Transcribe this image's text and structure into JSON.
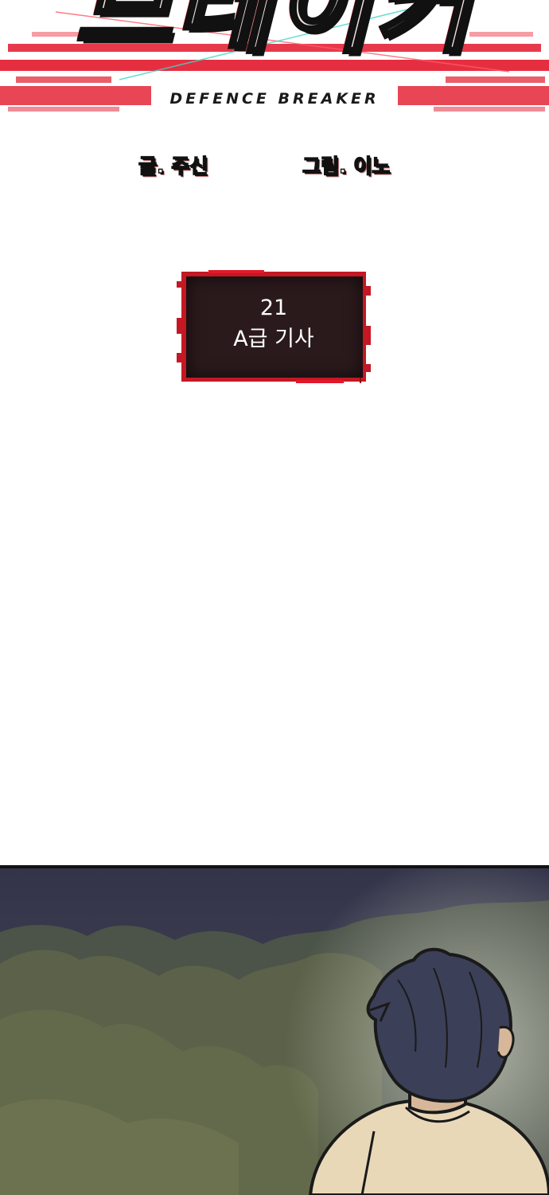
{
  "series": {
    "title_korean": "브레이커",
    "title_english": "DEFENCE BREAKER"
  },
  "credits": {
    "writer": "글. 주신",
    "artist": "그림. 이노"
  },
  "chapter": {
    "number": "21",
    "title": "A급 기사"
  },
  "colors": {
    "accent_red": "#e2182b",
    "chapter_box_bg": "#2b1a1c",
    "panel_sky": "#3e3f4f",
    "panel_foliage": "#59604a",
    "character_hair": "#3b3f57",
    "character_shirt": "#e9d8b8"
  }
}
